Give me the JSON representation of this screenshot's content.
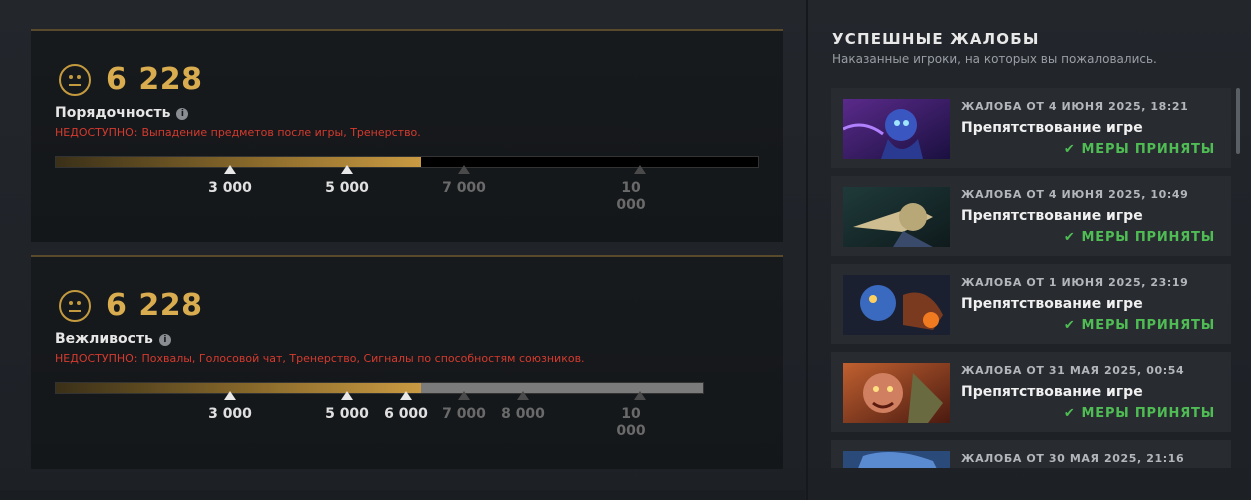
{
  "metrics": [
    {
      "score": "6 228",
      "title": "Порядочность",
      "info": "i",
      "unavailable_label": "НЕДОСТУПНО:",
      "unavailable_text": "Выпадение предметов после игры, Тренерство.",
      "fill_fraction": 0.518,
      "ticks": [
        "3 000",
        "5 000",
        "7 000",
        "10 000"
      ]
    },
    {
      "score": "6 228",
      "title": "Вежливость",
      "info": "i",
      "unavailable_label": "НЕДОСТУПНО:",
      "unavailable_text": "Похвалы, Голосовой чат, Тренерство, Сигналы по способностям союзников.",
      "fill_fraction": 0.56,
      "ticks": [
        "3 000",
        "5 000",
        "6 000",
        "7 000",
        "8 000",
        "10 000"
      ]
    }
  ],
  "reports_panel": {
    "title": "УСПЕШНЫЕ ЖАЛОБЫ",
    "subtitle": "Наказанные игроки, на которых вы пожаловались.",
    "status_icon": "check-icon",
    "items": [
      {
        "date": "ЖАЛОБА ОТ 4 ИЮНЯ 2025, 18:21",
        "reason": "Препятствование игре",
        "status": "МЕРЫ ПРИНЯТЫ"
      },
      {
        "date": "ЖАЛОБА ОТ 4 ИЮНЯ 2025, 10:49",
        "reason": "Препятствование игре",
        "status": "МЕРЫ ПРИНЯТЫ"
      },
      {
        "date": "ЖАЛОБА ОТ 1 ИЮНЯ 2025, 23:19",
        "reason": "Препятствование игре",
        "status": "МЕРЫ ПРИНЯТЫ"
      },
      {
        "date": "ЖАЛОБА ОТ 31 МАЯ 2025, 00:54",
        "reason": "Препятствование игре",
        "status": "МЕРЫ ПРИНЯТЫ"
      },
      {
        "date": "ЖАЛОБА ОТ 30 МАЯ 2025, 21:16",
        "reason": "",
        "status": ""
      }
    ]
  },
  "colors": {
    "accent_gold": "#d9ad4f",
    "unavailable_red": "#d63a2e",
    "success_green": "#4fbd54"
  }
}
